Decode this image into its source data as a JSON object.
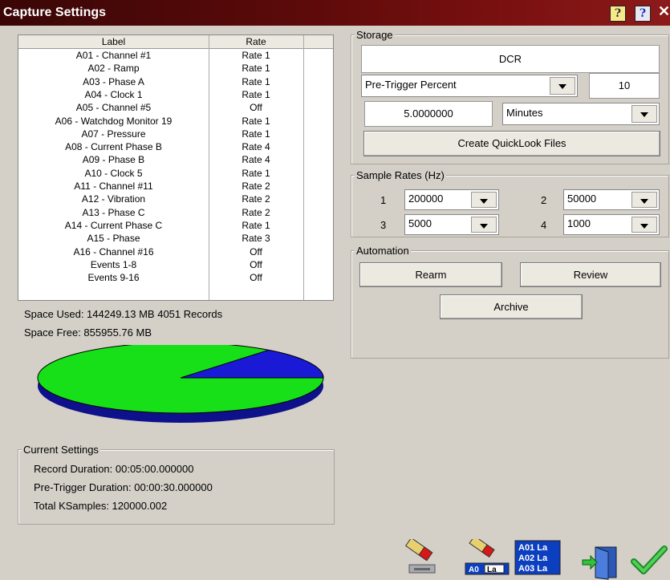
{
  "window": {
    "title": "Capture Settings"
  },
  "channels": {
    "headers": {
      "label": "Label",
      "rate": "Rate"
    },
    "rows": [
      {
        "label": "A01 - Channel #1",
        "rate": "Rate 1"
      },
      {
        "label": "A02 - Ramp",
        "rate": "Rate 1"
      },
      {
        "label": "A03 - Phase A",
        "rate": "Rate 1"
      },
      {
        "label": "A04 - Clock 1",
        "rate": "Rate 1"
      },
      {
        "label": "A05 - Channel #5",
        "rate": "Off"
      },
      {
        "label": "A06 - Watchdog Monitor 19",
        "rate": "Rate 1"
      },
      {
        "label": "A07 - Pressure",
        "rate": "Rate 1"
      },
      {
        "label": "A08 - Current Phase B",
        "rate": "Rate 4"
      },
      {
        "label": "A09 - Phase B",
        "rate": "Rate 4"
      },
      {
        "label": "A10 - Clock 5",
        "rate": "Rate 1"
      },
      {
        "label": "A11 - Channel #11",
        "rate": "Rate 2"
      },
      {
        "label": "A12 - Vibration",
        "rate": "Rate 2"
      },
      {
        "label": "A13 - Phase C",
        "rate": "Rate 2"
      },
      {
        "label": "A14 - Current Phase C",
        "rate": "Rate 1"
      },
      {
        "label": "A15 - Phase",
        "rate": "Rate 3"
      },
      {
        "label": "A16 - Channel #16",
        "rate": "Off"
      },
      {
        "label": "Events 1-8",
        "rate": "Off"
      },
      {
        "label": "Events 9-16",
        "rate": "Off"
      }
    ]
  },
  "space": {
    "used": "Space Used: 144249.13 MB  4051 Records",
    "free": "Space Free: 855955.76 MB",
    "used_fraction": 0.1443,
    "used_color": "#1a1ad6",
    "free_color": "#18e018"
  },
  "current_settings": {
    "title": "Current Settings",
    "record_duration": "Record Duration: 00:05:00.000000",
    "pre_trigger_duration": "Pre-Trigger Duration: 00:00:30.000000",
    "total_ksamples": "Total KSamples: 120000.002"
  },
  "storage": {
    "title": "Storage",
    "mode": "DCR",
    "trigger_type": "Pre-Trigger Percent",
    "trigger_value": "10",
    "duration_value": "5.0000000",
    "duration_unit": "Minutes",
    "quicklook_button": "Create QuickLook Files"
  },
  "sample_rates": {
    "title": "Sample Rates (Hz)",
    "rates": [
      {
        "index": "1",
        "value": "200000"
      },
      {
        "index": "2",
        "value": "50000"
      },
      {
        "index": "3",
        "value": "5000"
      },
      {
        "index": "4",
        "value": "1000"
      }
    ]
  },
  "automation": {
    "title": "Automation",
    "rearm": "Rearm",
    "review": "Review",
    "archive": "Archive"
  },
  "toolbar": {
    "label_tag_1": "A01 La",
    "label_tag_2": "A02 La",
    "label_tag_3": "A03 La",
    "label_tag_small": "A0",
    "label_tag_small2": "La",
    "icons": [
      "eraser-device-icon",
      "eraser-label-icon",
      "channel-labels-icon",
      "exit-door-icon",
      "ok-checkmark-icon"
    ]
  }
}
